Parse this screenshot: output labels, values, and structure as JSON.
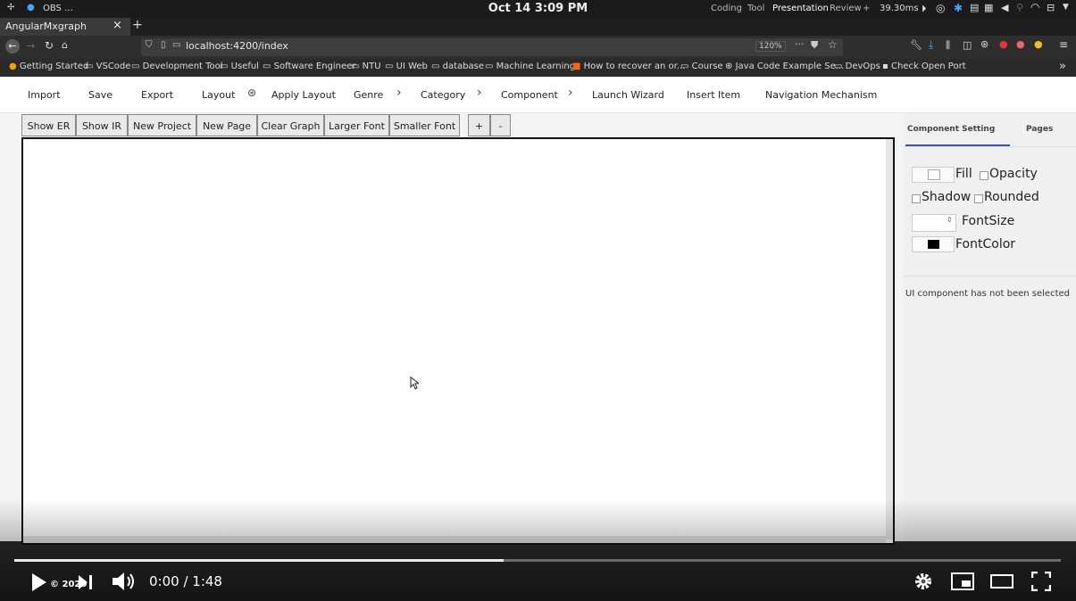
{
  "os": {
    "app_name": "OBS ...",
    "clock": "Oct 14  3:09 PM",
    "workspaces": [
      "Coding",
      "Tool",
      "Presentation",
      "Review"
    ],
    "active_workspace": "Presentation",
    "plus": "+",
    "latency": "39.30ms"
  },
  "browser": {
    "tab_title": "AngularMxgraph",
    "tab_close": "×",
    "new_tab": "+",
    "url": "localhost:4200/index",
    "zoom": "120%",
    "bookmarks": [
      "Getting Started",
      "VSCode",
      "Development Tool",
      "Useful",
      "Software Engineer",
      "NTU",
      "UI Web",
      "database",
      "Machine Learning",
      "How to recover an or...",
      "Course",
      "Java Code Example Se...",
      "DevOps",
      "Check Open Port"
    ],
    "bookmarks_more": "»"
  },
  "menu": {
    "items": [
      "Import",
      "Save",
      "Export",
      "Layout",
      "Apply Layout",
      "Genre",
      "Category",
      "Component",
      "Launch Wizard",
      "Insert Item",
      "Navigation Mechanism"
    ]
  },
  "toolbar": {
    "buttons": [
      "Show ER",
      "Show IR",
      "New Project",
      "New Page",
      "Clear Graph",
      "Larger Font",
      "Smaller Font"
    ],
    "zoom_in": "+",
    "zoom_out": "-"
  },
  "panel": {
    "tabs": [
      "Component Setting",
      "Pages"
    ],
    "active_tab": "Component Setting",
    "fill_label": "Fill",
    "opacity_label": "Opacity",
    "shadow_label": "Shadow",
    "rounded_label": "Rounded",
    "fontsize_label": "FontSize",
    "fontcolor_label": "FontColor",
    "font_color": "#000000",
    "accent": "#3f51b5",
    "status": "UI component has not been selected"
  },
  "video": {
    "time": "0:00 / 1:48",
    "copyright": "© 2020",
    "progress": 0.468
  }
}
